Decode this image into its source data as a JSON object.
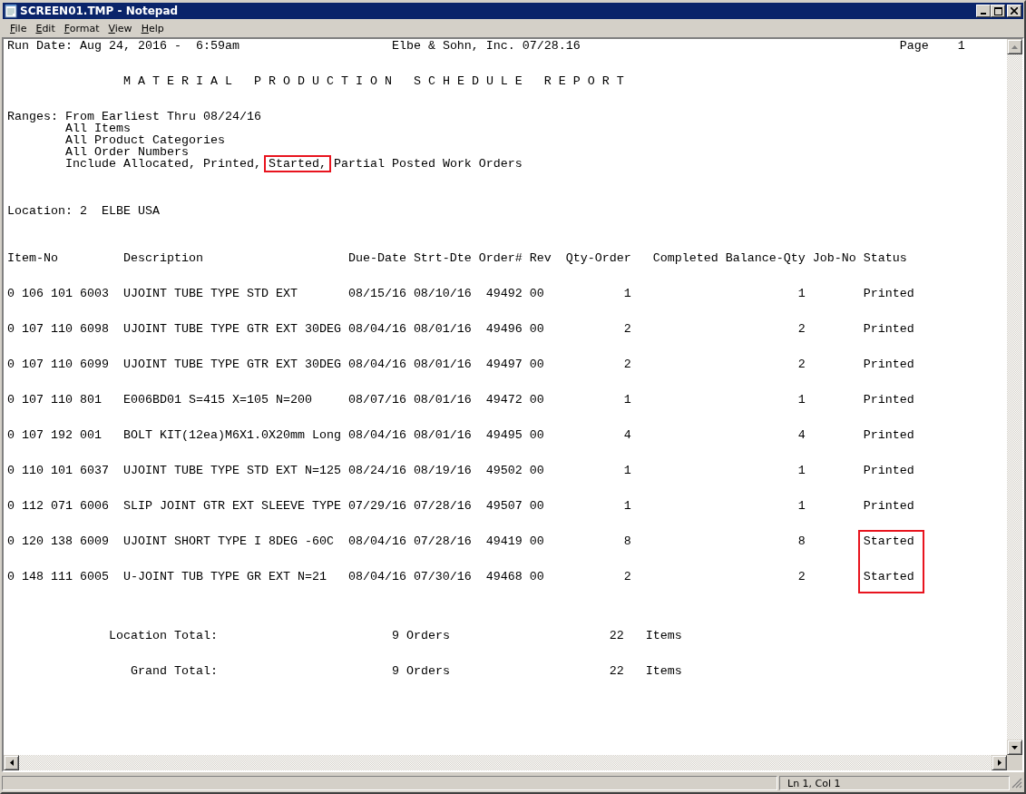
{
  "window": {
    "title": "SCREEN01.TMP - Notepad"
  },
  "menu": [
    "File",
    "Edit",
    "Format",
    "View",
    "Help"
  ],
  "report": {
    "run_date": "Run Date: Aug 24, 2016 -  6:59am",
    "company": "Elbe & Sohn, Inc. 07/28.16",
    "page_label": "Page",
    "page_number": "1",
    "title": "M A T E R I A L   P R O D U C T I O N   S C H E D U L E   R E P O R T",
    "ranges_label": "Ranges:",
    "ranges": [
      [
        {
          "text": "From Earliest Thru 08/24/16",
          "highlighted": false
        }
      ],
      [
        {
          "text": "All Items",
          "highlighted": false
        }
      ],
      [
        {
          "text": "All Product Categories",
          "highlighted": false
        }
      ],
      [
        {
          "text": "All Order Numbers",
          "highlighted": false
        }
      ],
      [
        {
          "text": "Include Allocated, Printed,",
          "highlighted": false
        },
        {
          "text": "Started,",
          "highlighted": true
        },
        {
          "text": "Partial Posted Work Orders",
          "highlighted": false
        }
      ]
    ],
    "location": "Location: 2  ELBE USA",
    "columns": [
      "Item-No",
      "Description",
      "Due-Date",
      "Strt-Dte",
      "Order#",
      "Rev",
      "Qty-Order",
      "Completed",
      "Balance-Qty",
      "Job-No",
      "Status"
    ],
    "rows": [
      {
        "item_no": "0 106 101 6003",
        "description": "UJOINT TUBE TYPE STD EXT",
        "due_date": "08/15/16",
        "start_date": "08/10/16",
        "order_no": "49492",
        "rev": "00",
        "qty_order": "1",
        "balance_qty": "1",
        "status": "Printed",
        "highlighted": false
      },
      {
        "item_no": "0 107 110 6098",
        "description": "UJOINT TUBE TYPE GTR EXT 30DEG",
        "due_date": "08/04/16",
        "start_date": "08/01/16",
        "order_no": "49496",
        "rev": "00",
        "qty_order": "2",
        "balance_qty": "2",
        "status": "Printed",
        "highlighted": false
      },
      {
        "item_no": "0 107 110 6099",
        "description": "UJOINT TUBE TYPE GTR EXT 30DEG",
        "due_date": "08/04/16",
        "start_date": "08/01/16",
        "order_no": "49497",
        "rev": "00",
        "qty_order": "2",
        "balance_qty": "2",
        "status": "Printed",
        "highlighted": false
      },
      {
        "item_no": "0 107 110 801",
        "description": "E006BD01 S=415 X=105 N=200",
        "due_date": "08/07/16",
        "start_date": "08/01/16",
        "order_no": "49472",
        "rev": "00",
        "qty_order": "1",
        "balance_qty": "1",
        "status": "Printed",
        "highlighted": false
      },
      {
        "item_no": "0 107 192 001",
        "description": "BOLT KIT(12ea)M6X1.0X20mm Long",
        "due_date": "08/04/16",
        "start_date": "08/01/16",
        "order_no": "49495",
        "rev": "00",
        "qty_order": "4",
        "balance_qty": "4",
        "status": "Printed",
        "highlighted": false
      },
      {
        "item_no": "0 110 101 6037",
        "description": "UJOINT TUBE TYPE STD EXT N=125",
        "due_date": "08/24/16",
        "start_date": "08/19/16",
        "order_no": "49502",
        "rev": "00",
        "qty_order": "1",
        "balance_qty": "1",
        "status": "Printed",
        "highlighted": false
      },
      {
        "item_no": "0 112 071 6006",
        "description": "SLIP JOINT GTR EXT SLEEVE TYPE",
        "due_date": "07/29/16",
        "start_date": "07/28/16",
        "order_no": "49507",
        "rev": "00",
        "qty_order": "1",
        "balance_qty": "1",
        "status": "Printed",
        "highlighted": false
      },
      {
        "item_no": "0 120 138 6009",
        "description": "UJOINT SHORT TYPE I 8DEG -60C",
        "due_date": "08/04/16",
        "start_date": "07/28/16",
        "order_no": "49419",
        "rev": "00",
        "qty_order": "8",
        "balance_qty": "8",
        "status": "Started",
        "highlighted": true
      },
      {
        "item_no": "0 148 111 6005",
        "description": "U-JOINT TUB TYPE GR EXT N=21",
        "due_date": "08/04/16",
        "start_date": "07/30/16",
        "order_no": "49468",
        "rev": "00",
        "qty_order": "2",
        "balance_qty": "2",
        "status": "Started",
        "highlighted": true
      }
    ],
    "totals": [
      {
        "label": "Location Total:",
        "orders": "9 Orders",
        "count": "22",
        "unit": "Items"
      },
      {
        "label": "Grand Total:",
        "orders": "9 Orders",
        "count": "22",
        "unit": "Items"
      }
    ]
  },
  "status_bar": {
    "position": "Ln 1, Col 1"
  }
}
